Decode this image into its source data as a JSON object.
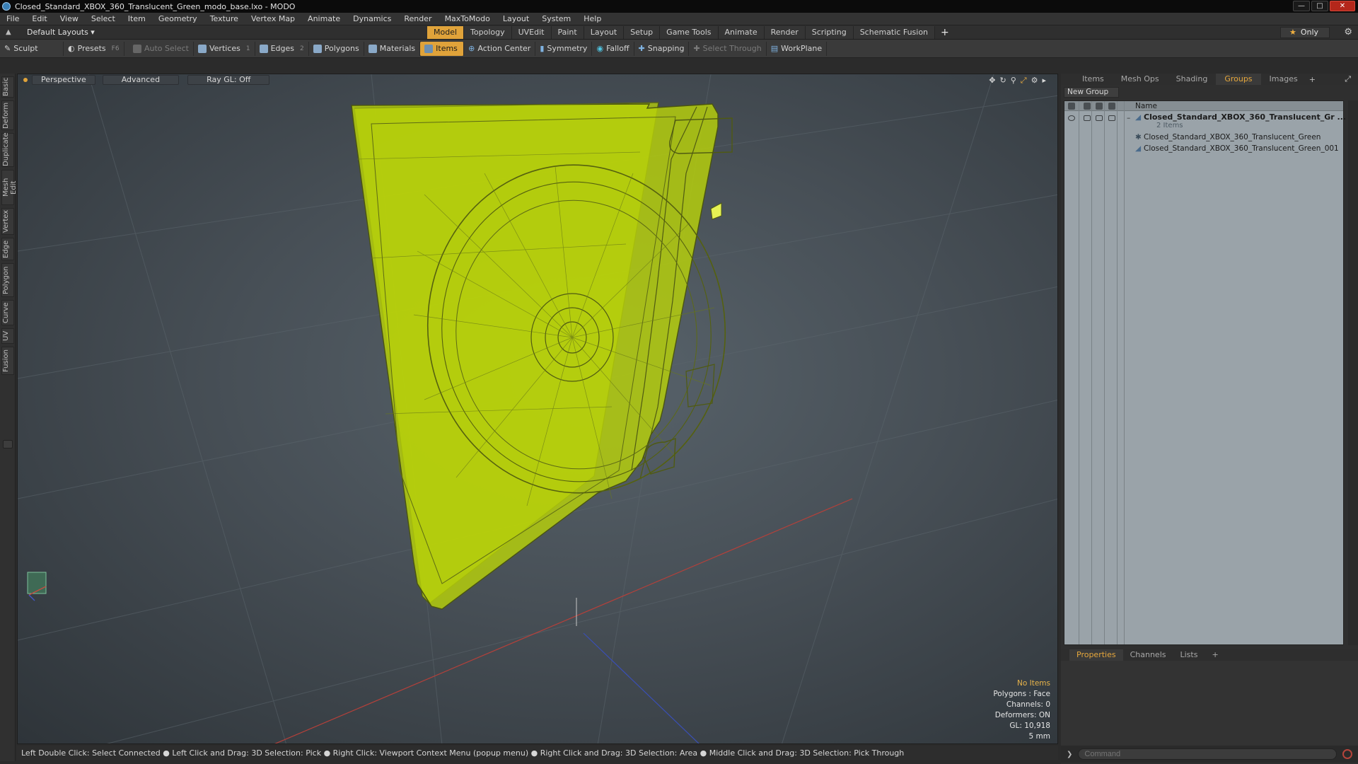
{
  "window": {
    "title": "Closed_Standard_XBOX_360_Translucent_Green_modo_base.lxo - MODO"
  },
  "menu": [
    "File",
    "Edit",
    "View",
    "Select",
    "Item",
    "Geometry",
    "Texture",
    "Vertex Map",
    "Animate",
    "Dynamics",
    "Render",
    "MaxToModo",
    "Layout",
    "System",
    "Help"
  ],
  "layout_bar": {
    "layouts_label": "Default Layouts ▾",
    "tabs": [
      "Model",
      "Topology",
      "UVEdit",
      "Paint",
      "Layout",
      "Setup",
      "Game Tools",
      "Animate",
      "Render",
      "Scripting",
      "Schematic Fusion"
    ],
    "active_tab": "Model",
    "add": "+",
    "only_label": "Only"
  },
  "toolbar": {
    "sculpt": "Sculpt",
    "presets": "Presets",
    "presets_key": "F6",
    "auto_select": "Auto Select",
    "vertices": "Vertices",
    "vertices_num": "1",
    "edges": "Edges",
    "edges_num": "2",
    "polygons": "Polygons",
    "materials": "Materials",
    "items": "Items",
    "action_center": "Action Center",
    "symmetry": "Symmetry",
    "falloff": "Falloff",
    "snapping": "Snapping",
    "select_through": "Select Through",
    "workplane": "WorkPlane"
  },
  "left_tabs": [
    "Basic",
    "Deform",
    "Duplicate",
    "Mesh Edit",
    "Vertex",
    "Edge",
    "Polygon",
    "Curve",
    "UV",
    "Fusion"
  ],
  "viewport": {
    "view": "Perspective",
    "shading": "Advanced",
    "raygl": "Ray GL: Off",
    "mesh_color": "#b8d20a",
    "stats": {
      "items": "No Items",
      "polygons": "Polygons : Face",
      "channels": "Channels: 0",
      "deformers": "Deformers: ON",
      "gl": "GL: 10,918",
      "scale": "5 mm"
    }
  },
  "status_bar": "Left Double Click: Select Connected ● Left Click and Drag: 3D Selection: Pick ● Right Click: Viewport Context Menu (popup menu) ● Right Click and Drag: 3D Selection: Area ● Middle Click and Drag: 3D Selection: Pick Through",
  "right_panel": {
    "tabs": [
      "Items",
      "Mesh Ops",
      "Shading",
      "Groups",
      "Images"
    ],
    "active_tab": "Groups",
    "new_group": "New Group",
    "column_name": "Name",
    "group": {
      "name": "Closed_Standard_XBOX_360_Translucent_Gr ...",
      "count": "2 Items",
      "children": [
        "Closed_Standard_XBOX_360_Translucent_Green",
        "Closed_Standard_XBOX_360_Translucent_Green_001"
      ]
    },
    "bottom_tabs": [
      "Properties",
      "Channels",
      "Lists"
    ],
    "bottom_active": "Properties",
    "command_placeholder": "Command"
  }
}
